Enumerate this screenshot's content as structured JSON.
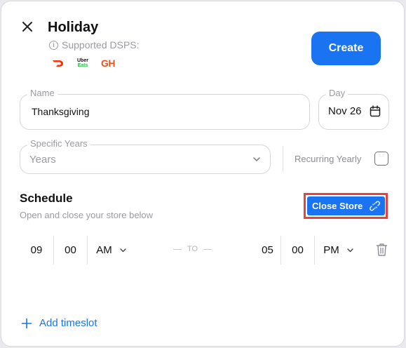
{
  "dialog": {
    "title": "Holiday",
    "supported_label": "Supported DSPS:",
    "dsps": [
      {
        "icon": "doordash-logo-icon",
        "color": "#ff3008"
      },
      {
        "icon": "ubereats-logo-icon",
        "line1": "Uber",
        "line2": "Eats"
      },
      {
        "icon": "grubhub-logo-icon",
        "text": "GH",
        "color": "#f0521e"
      }
    ],
    "create_label": "Create"
  },
  "form": {
    "name": {
      "label": "Name",
      "value": "Thanksgiving"
    },
    "day": {
      "label": "Day",
      "value": "Nov 26"
    },
    "specific_years": {
      "label": "Specific Years",
      "placeholder": "Years"
    },
    "recurring": {
      "label": "Recurring Yearly",
      "checked": false
    }
  },
  "schedule": {
    "title": "Schedule",
    "subtitle": "Open and close your store below",
    "close_store_label": "Close Store",
    "timeslots": [
      {
        "start": {
          "hour": "09",
          "minute": "00",
          "ampm": "AM"
        },
        "to_label": "TO",
        "end": {
          "hour": "05",
          "minute": "00",
          "ampm": "PM"
        }
      }
    ],
    "add_timeslot_label": "Add timeslot"
  },
  "colors": {
    "accent": "#1a73f0",
    "highlight_outline": "#e8413f"
  }
}
